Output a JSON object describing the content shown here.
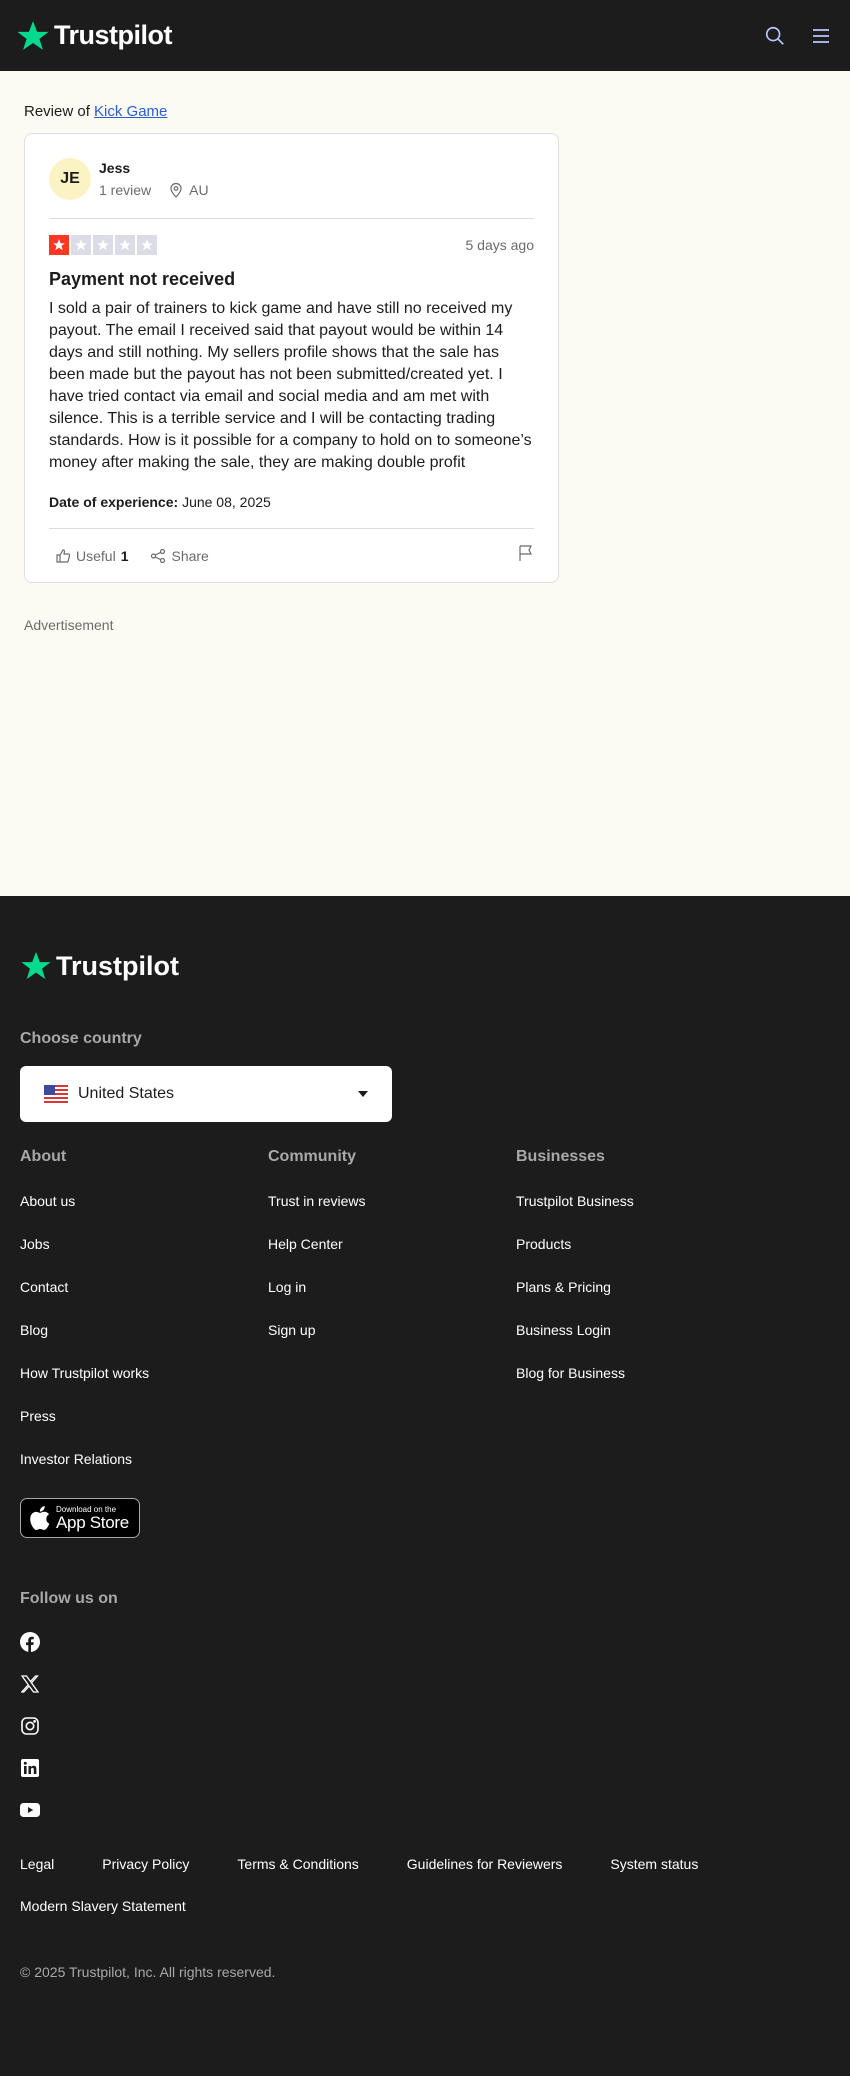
{
  "header": {
    "brand": "Trustpilot",
    "logo_icon": "star-icon",
    "search_icon": "search-icon",
    "menu_icon": "menu-icon"
  },
  "review_of": {
    "prefix": "Review of",
    "company": "Kick Game"
  },
  "review": {
    "avatar_initials": "JE",
    "reviewer_name": "Jess",
    "review_count": "1 review",
    "location": "AU",
    "rating": 1,
    "max_rating": 5,
    "date": "5 days ago",
    "title": "Payment not received",
    "body": "I sold a pair of trainers to kick game and have still no received my payout. The email I received said that payout would be within 14 days and still nothing. My sellers profile shows that the sale has been made but the payout has not been submitted/created yet. I have tried contact via email and social media and am met with silence. This is a terrible service and I will be contacting trading standards. How is it possible for a company to hold on to someone’s money after making the sale, they are making double profit",
    "experience_label": "Date of experience:",
    "experience_date": "June 08, 2025",
    "useful_label": "Useful",
    "useful_count": "1",
    "share_label": "Share"
  },
  "advertisement": "Advertisement",
  "footer": {
    "brand": "Trustpilot",
    "choose_country": "Choose country",
    "country_selected": "United States",
    "columns": [
      {
        "title": "About",
        "links": [
          "About us",
          "Jobs",
          "Contact",
          "Blog",
          "How Trustpilot works",
          "Press",
          "Investor Relations"
        ]
      },
      {
        "title": "Community",
        "links": [
          "Trust in reviews",
          "Help Center",
          "Log in",
          "Sign up"
        ]
      },
      {
        "title": "Businesses",
        "links": [
          "Trustpilot Business",
          "Products",
          "Plans & Pricing",
          "Business Login",
          "Blog for Business"
        ]
      }
    ],
    "app_store": {
      "small": "Download on the",
      "big": "App Store"
    },
    "follow_us": "Follow us on",
    "socials": [
      "facebook-icon",
      "x-icon",
      "instagram-icon",
      "linkedin-icon",
      "youtube-icon"
    ],
    "legal_links": [
      "Legal",
      "Privacy Policy",
      "Terms & Conditions",
      "Guidelines for Reviewers",
      "System status",
      "Modern Slavery Statement"
    ],
    "copyright": "© 2025 Trustpilot, Inc. All rights reserved."
  },
  "colors": {
    "brand_green": "#04da8d",
    "star_red": "#ff3722",
    "dark": "#1c1c1c",
    "link_blue": "#2b5bd6"
  }
}
